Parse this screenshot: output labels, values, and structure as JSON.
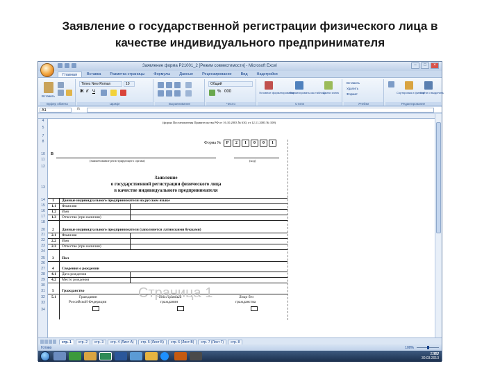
{
  "slide": {
    "title_line1": "Заявление о государственной регистрации физического лица в",
    "title_line2": "качестве индивидуального предпринимателя"
  },
  "window": {
    "title": "Заявление форма Р21001_2 [Режим совместимости] - Microsoft Excel",
    "controls": [
      "–",
      "□",
      "×"
    ]
  },
  "ribbon": {
    "tabs": [
      "Главная",
      "Вставка",
      "Разметка страницы",
      "Формулы",
      "Данные",
      "Рецензирование",
      "Вид",
      "Надстройки"
    ],
    "active_tab": "Главная",
    "font_name": "Times New Roman",
    "font_size": "10",
    "number_format": "Общий",
    "groups": [
      "Буфер обмена",
      "Шрифт",
      "Выравнивание",
      "Число",
      "Стили",
      "Ячейки",
      "Редактирование"
    ],
    "buttons": {
      "paste": "Вставить",
      "conditional": "Условное форматирование",
      "format_table": "Форматировать как таблицу",
      "cell_styles": "Стили ячеек",
      "insert": "Вставить",
      "delete": "Удалить",
      "format": "Формат",
      "sort": "Сортировка и фильтр",
      "find": "Найти и выделить"
    }
  },
  "formula_bar": {
    "name_box": "A1",
    "fx": "fx",
    "value": ""
  },
  "row_numbers": [
    "4",
    "5",
    "7",
    "8",
    "10",
    "11",
    "12",
    "13",
    "14",
    "15",
    "16",
    "17",
    "18",
    "20",
    "21",
    "22",
    "23",
    "24",
    "25",
    "26",
    "27",
    "28",
    "29",
    "30",
    "31",
    "32",
    "33",
    "34"
  ],
  "sheet": {
    "appendix": "(форма Постановления Правительства РФ от 16.10.2003 № 630, от 12.11.2003 № 100)",
    "form_label": "Форма №",
    "form_code": [
      "Р",
      "2",
      "1",
      "0",
      "0",
      "1"
    ],
    "to_label": "В",
    "authority_caption": "(наименование регистрирующего органа)",
    "code_caption": "(код)",
    "heading1": "Заявление",
    "heading2": "о государственной регистрации физического лица",
    "heading3": "в качестве индивидуального предпринимателя",
    "sections": [
      {
        "num": "1",
        "title": "Данные индивидуального предпринимателя на русском языке"
      },
      {
        "num": "2",
        "title": "Данные индивидуального предпринимателя (заполняется латинскими буквами)"
      },
      {
        "num": "3",
        "title": "Пол"
      },
      {
        "num": "4",
        "title": "Сведения о рождении"
      },
      {
        "num": "5",
        "title": "Гражданство"
      }
    ],
    "s1_rows": [
      {
        "num": "1.1",
        "label": "Фамилия"
      },
      {
        "num": "1.2",
        "label": "Имя"
      },
      {
        "num": "1.3",
        "label": "Отчество (при наличии)"
      }
    ],
    "s2_rows": [
      {
        "num": "2.1",
        "label": "Фамилия"
      },
      {
        "num": "2.2",
        "label": "Имя"
      },
      {
        "num": "2.3",
        "label": "Отчество (при наличии)"
      }
    ],
    "s4_rows": [
      {
        "num": "4.1",
        "label": "Дата рождения"
      },
      {
        "num": "4.2",
        "label": "Место рождения"
      }
    ],
    "s5_num": "5.1",
    "citizenship": [
      {
        "line1": "Гражданин",
        "line2": "Российской Федерации"
      },
      {
        "line1": "Иностранный",
        "line2": "гражданин"
      },
      {
        "line1": "Лицо без",
        "line2": "гражданства"
      }
    ],
    "page_watermark": "Страница 1"
  },
  "sheet_tabs": [
    "стр. 1",
    "стр. 2",
    "стр. 3",
    "стр. 4 (Лист А)",
    "стр. 5 (Лист Б)",
    "стр. 6 (Лист В)",
    "стр. 7 (Лист Г)",
    "стр. 8"
  ],
  "active_sheet": "стр. 1",
  "status": {
    "ready": "Готово",
    "zoom": "100%",
    "zoom_level": 0.5
  },
  "taskbar": {
    "lang": "RU",
    "time": "22:07",
    "date": "30.03.2013"
  },
  "colors": {
    "ribbon_bg": "#d9e6f5",
    "title_accent": "#15428b",
    "taskbar": "#1b2f4d"
  }
}
